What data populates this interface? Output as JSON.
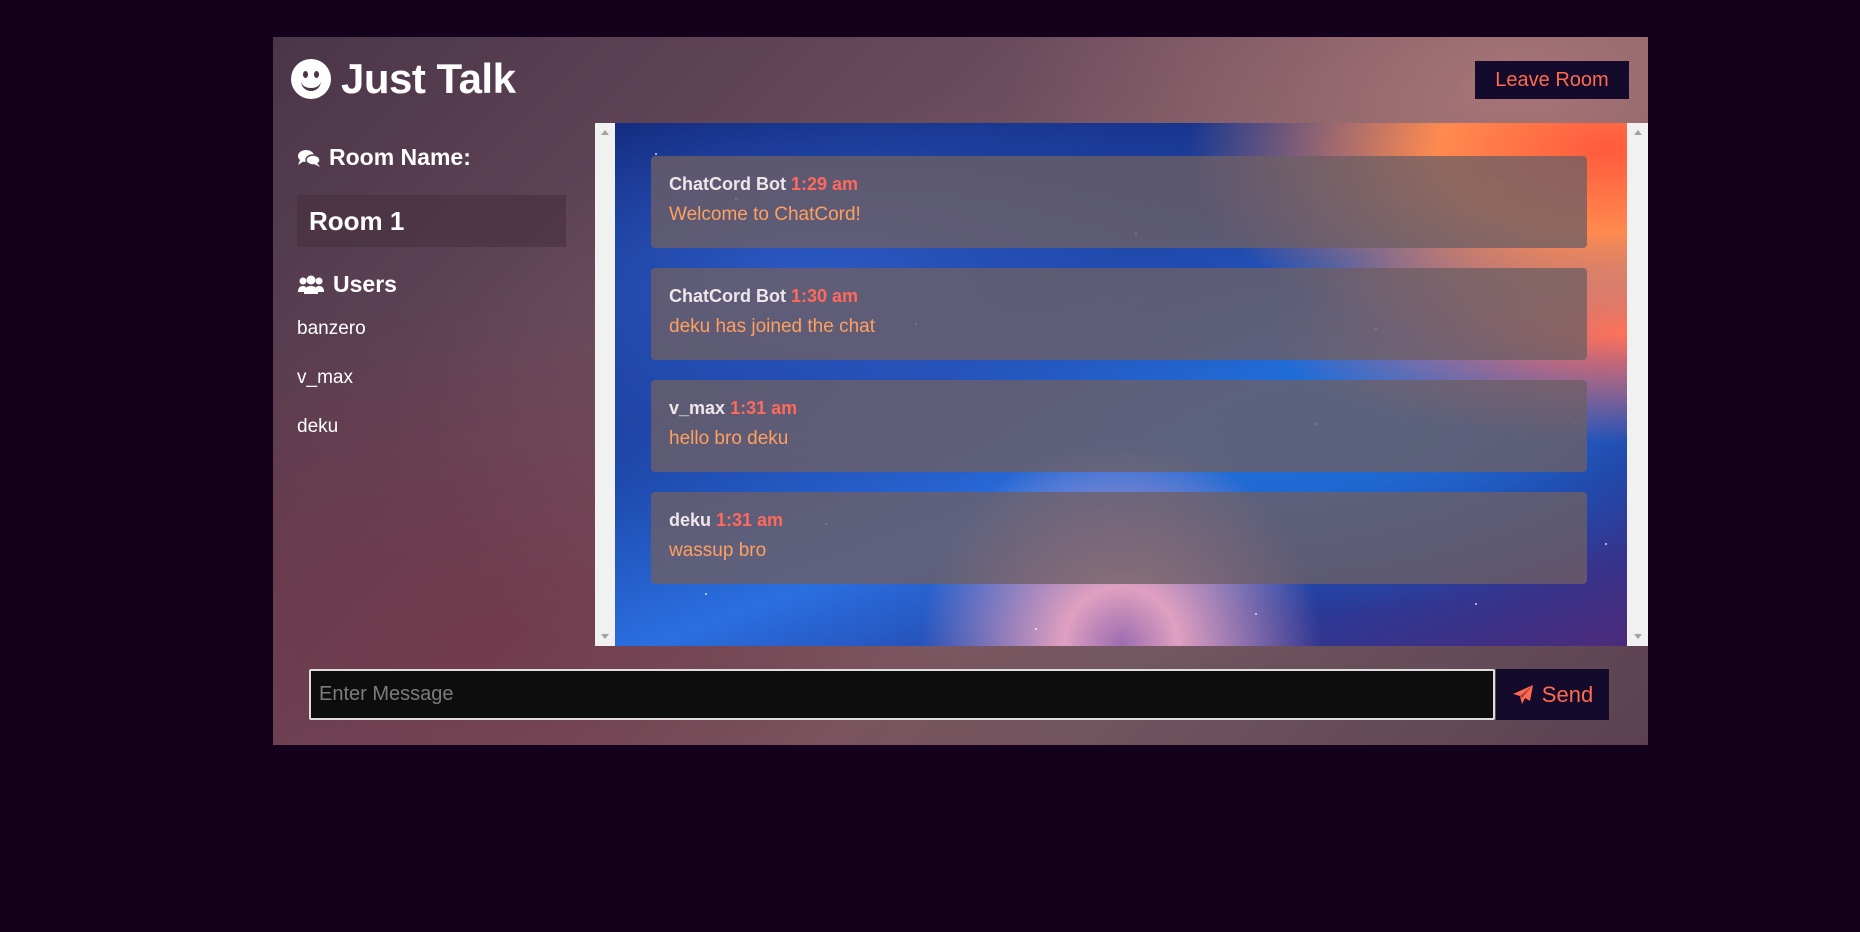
{
  "app": {
    "title": "Just Talk"
  },
  "header": {
    "leave_label": "Leave Room"
  },
  "sidebar": {
    "room_heading": "Room Name:",
    "room_name": "Room 1",
    "users_heading": "Users",
    "users": [
      "banzero",
      "v_max",
      "deku"
    ]
  },
  "messages": [
    {
      "user": "ChatCord Bot",
      "time": "1:29 am",
      "text": "Welcome to ChatCord!"
    },
    {
      "user": "ChatCord Bot",
      "time": "1:30 am",
      "text": "deku has joined the chat"
    },
    {
      "user": "v_max",
      "time": "1:31 am",
      "text": "hello bro deku"
    },
    {
      "user": "deku",
      "time": "1:31 am",
      "text": "wassup bro"
    }
  ],
  "compose": {
    "placeholder": "Enter Message",
    "send_label": "Send"
  },
  "colors": {
    "accent": "#ff6a4e",
    "button_bg": "#140a2c",
    "page_bg": "#14021c",
    "message_text": "#ffa060"
  }
}
